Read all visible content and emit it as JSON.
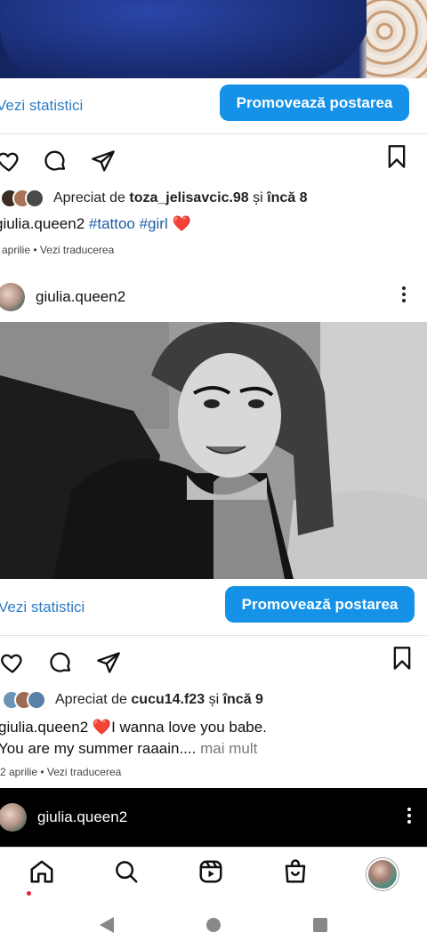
{
  "post1": {
    "stats_label": "Vezi statistici",
    "promote_label": "Promovează postarea",
    "likes_prefix": "Apreciat de",
    "likes_user": "toza_jelisavcic.98",
    "likes_and": "și",
    "likes_more": "încă 8",
    "caption_user": "giulia.queen2",
    "caption_tags": "#tattoo #girl",
    "caption_emoji": "❤️",
    "date": "aprilie",
    "translate": "Vezi traducerea"
  },
  "post2": {
    "username": "giulia.queen2",
    "stats_label": "Vezi statistici",
    "promote_label": "Promovează postarea",
    "likes_prefix": "Apreciat de",
    "likes_user": "cucu14.f23",
    "likes_and": "și",
    "likes_more": "încă 9",
    "caption_user": "giulia.queen2",
    "caption_emoji": "❤️",
    "caption_text1": "I wanna love you babe.",
    "caption_text2": "You are my summer raaain....",
    "more_label": "mai mult",
    "date": "2 aprilie",
    "translate": "Vezi traducerea"
  },
  "post3": {
    "username": "giulia.queen2"
  },
  "nav": {
    "items": [
      "home-icon",
      "search-icon",
      "reels-icon",
      "shop-icon",
      "profile-avatar"
    ],
    "active_dot_color": "#e0243b"
  },
  "colors": {
    "accent": "#1592e8",
    "link": "#2e7dc4"
  }
}
